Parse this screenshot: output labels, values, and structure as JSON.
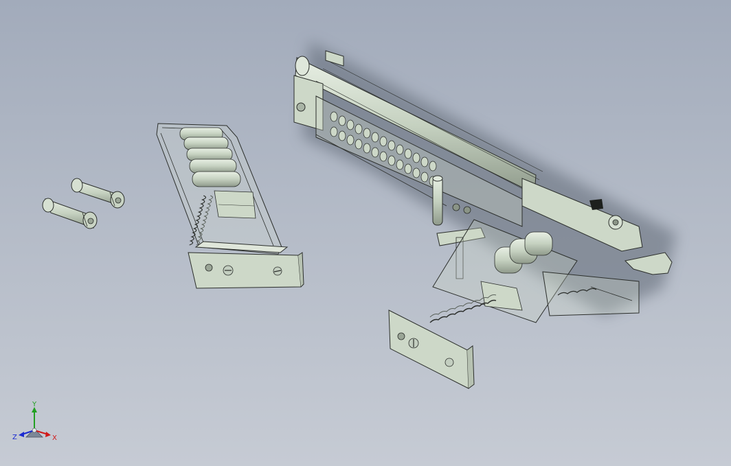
{
  "viewport": {
    "background_top": "#a2abbb",
    "background_bottom": "#c6cbd4",
    "model_fill": "#cdd8c8",
    "model_edge": "#2b2e2b"
  },
  "triad": {
    "x_label": "X",
    "y_label": "Y",
    "z_label": "Z",
    "x_color": "#d11a1a",
    "y_color": "#22a022",
    "z_color": "#1a2ad1"
  },
  "parts": {
    "cartridges": "cartridge",
    "magazine": "magazine",
    "pistol": "pistol-assembly"
  }
}
